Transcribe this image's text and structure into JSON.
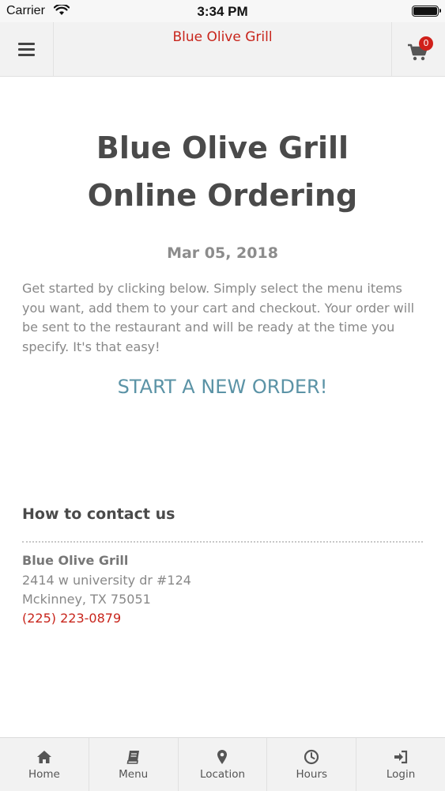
{
  "status_bar": {
    "carrier": "Carrier",
    "time": "3:34 PM"
  },
  "header": {
    "title": "Blue Olive Grill",
    "cart_count": "0",
    "menu_icon": "hamburger-icon",
    "cart_icon": "shopping-cart-icon"
  },
  "hero": {
    "title_line1": "Blue Olive Grill",
    "title_line2": "Online Ordering",
    "date": "Mar 05, 2018",
    "intro": "Get started by clicking below. Simply select the menu items you want, add them to your cart and checkout. Your order will be sent to the restaurant and will be ready at the time you specify. It's that easy!",
    "cta": "START A NEW ORDER!"
  },
  "contact": {
    "heading": "How to contact us",
    "name": "Blue Olive Grill",
    "street": "2414 w university dr #124",
    "city": "Mckinney, TX 75051",
    "phone": "(225) 223-0879"
  },
  "bottom_nav": [
    {
      "label": "Home",
      "icon": "home-icon"
    },
    {
      "label": "Menu",
      "icon": "book-icon"
    },
    {
      "label": "Location",
      "icon": "map-pin-icon"
    },
    {
      "label": "Hours",
      "icon": "clock-icon"
    },
    {
      "label": "Login",
      "icon": "login-icon"
    }
  ],
  "colors": {
    "brand_red": "#c8251c",
    "cta_blue": "#5b93a6",
    "badge_red": "#d0201a"
  }
}
